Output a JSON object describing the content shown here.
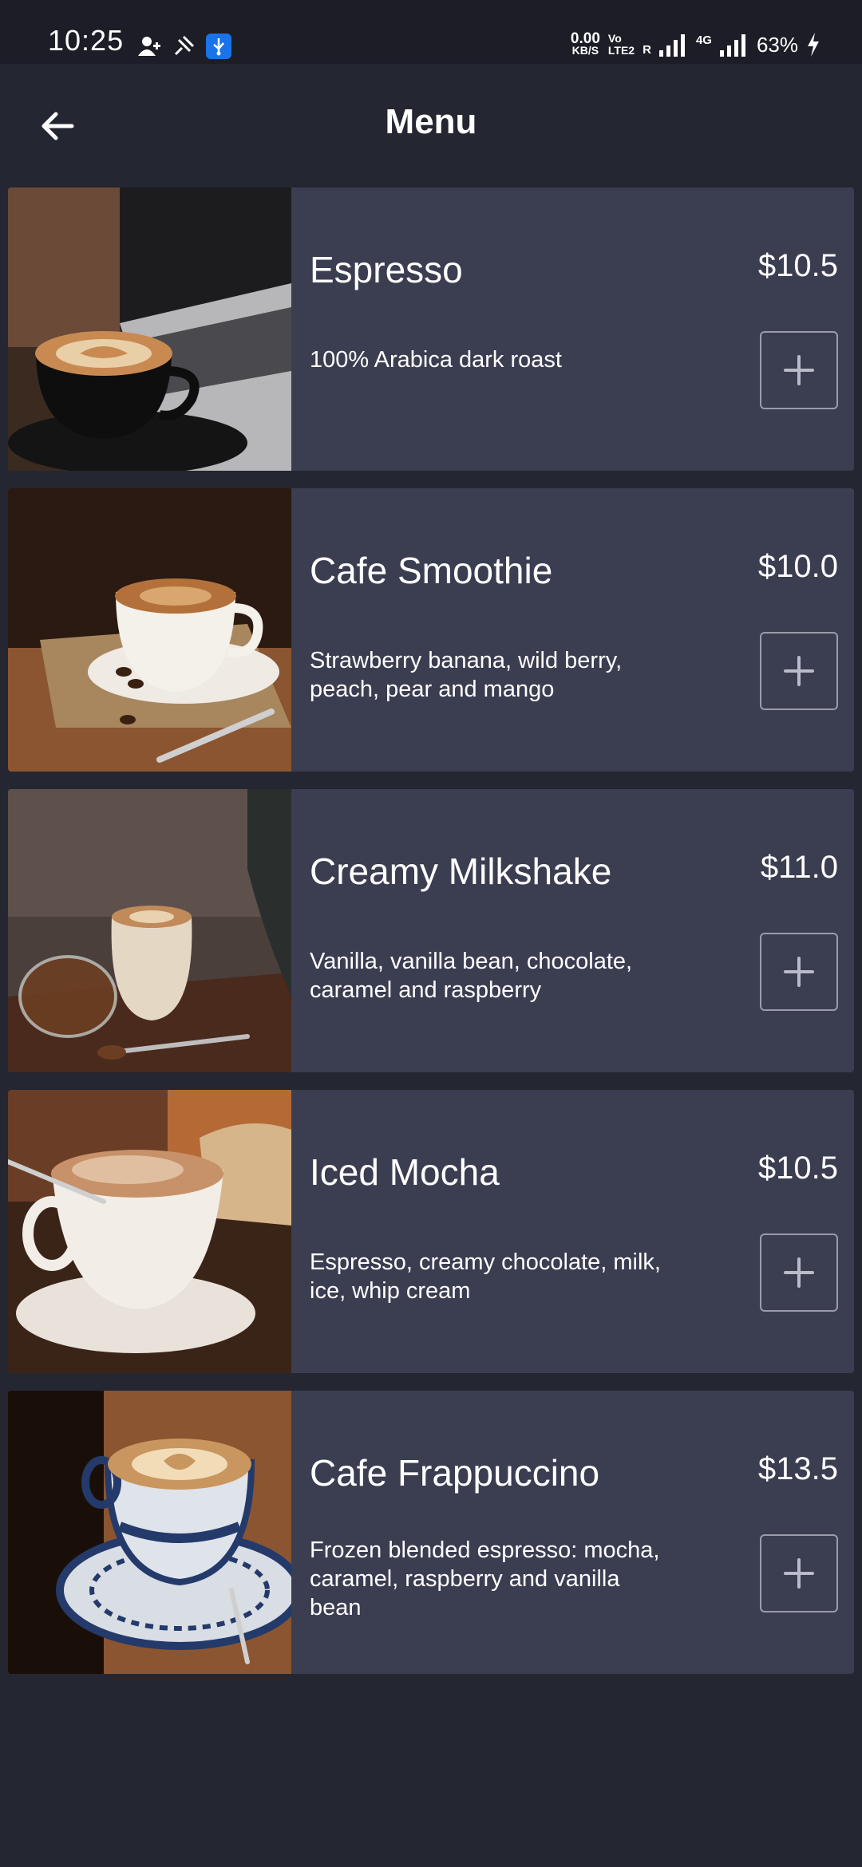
{
  "status_bar": {
    "time": "10:25",
    "net_speed_value": "0.00",
    "net_speed_unit": "KB/S",
    "volte_top": "Vo",
    "volte_bottom": "LTE2",
    "roaming": "R",
    "network_type": "4G",
    "battery": "63%"
  },
  "header": {
    "title": "Menu"
  },
  "menu": {
    "items": [
      {
        "name": "Espresso",
        "price": "$10.5",
        "description": "100% Arabica dark roast"
      },
      {
        "name": "Cafe Smoothie",
        "price": "$10.0",
        "description": "Strawberry banana, wild berry, peach, pear and mango"
      },
      {
        "name": "Creamy Milkshake",
        "price": "$11.0",
        "description": "Vanilla, vanilla bean, chocolate, caramel and raspberry"
      },
      {
        "name": "Iced Mocha",
        "price": "$10.5",
        "description": "Espresso, creamy chocolate, milk, ice, whip cream"
      },
      {
        "name": "Cafe Frappuccino",
        "price": "$13.5",
        "description": "Frozen blended espresso: mocha, caramel, raspberry and vanilla bean"
      }
    ]
  },
  "colors": {
    "background": "#242632",
    "card": "#3b3d51",
    "status_bar": "#1c1d27",
    "button_border": "#9a9cab"
  },
  "icons": {
    "back": "arrow-left-icon",
    "add": "plus-icon"
  }
}
